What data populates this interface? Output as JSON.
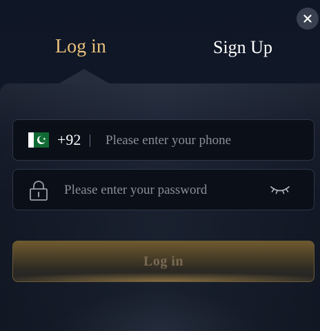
{
  "tabs": {
    "login_label": "Log in",
    "signup_label": "Sign Up",
    "active": "login"
  },
  "close_icon": "close-icon",
  "phone": {
    "country_flag": "pakistan-flag-icon",
    "country_code": "+92",
    "placeholder": "Please enter your phone",
    "value": ""
  },
  "password": {
    "lock_icon": "lock-icon",
    "placeholder": "Please enter your password",
    "value": "",
    "visibility_icon": "eye-closed-icon"
  },
  "submit": {
    "label": "Log in"
  },
  "colors": {
    "accent_gold": "#e8c07a",
    "background": "#121a2a",
    "field_bg": "#0a0f18"
  }
}
